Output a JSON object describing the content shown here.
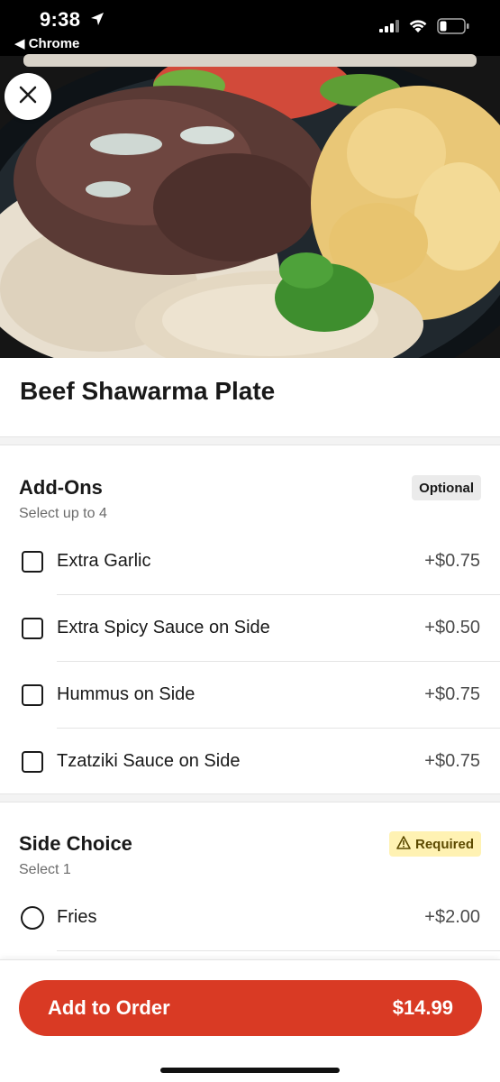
{
  "status_bar": {
    "time": "9:38",
    "back_app": "◀ Chrome"
  },
  "icons": {
    "close": "close-icon",
    "location": "location-arrow-icon",
    "signal": "cellular-signal-icon",
    "wifi": "wifi-icon",
    "battery": "battery-icon",
    "warning": "warning-icon"
  },
  "item": {
    "title": "Beef Shawarma Plate"
  },
  "addons": {
    "title": "Add-Ons",
    "subtitle": "Select up to 4",
    "badge": "Optional",
    "options": [
      {
        "label": "Extra Garlic",
        "price": "+$0.75",
        "checked": false
      },
      {
        "label": "Extra Spicy Sauce on Side",
        "price": "+$0.50",
        "checked": false
      },
      {
        "label": "Hummus on Side",
        "price": "+$0.75",
        "checked": false
      },
      {
        "label": "Tzatziki Sauce on Side",
        "price": "+$0.75",
        "checked": false
      }
    ]
  },
  "side_choice": {
    "title": "Side Choice",
    "subtitle": "Select 1",
    "badge": "Required",
    "options": [
      {
        "label": "Fries",
        "price": "+$2.00",
        "selected": false
      }
    ]
  },
  "footer": {
    "button_label": "Add to Order",
    "button_price": "$14.99"
  },
  "colors": {
    "accent": "#d93a24",
    "required_badge_bg": "#fff2b3",
    "optional_badge_bg": "#ebebeb"
  }
}
